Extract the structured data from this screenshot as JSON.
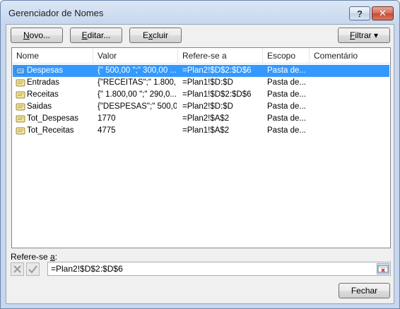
{
  "window": {
    "title": "Gerenciador de Nomes",
    "help_label": "?",
    "close_label": "✕"
  },
  "toolbar": {
    "new_label_u": "N",
    "new_label_rest": "ovo...",
    "edit_label_u": "E",
    "edit_label_rest": "ditar...",
    "delete_label_u": "x",
    "delete_label_pre": "E",
    "delete_label_rest": "cluir",
    "filter_label_u": "F",
    "filter_label_rest": "iltrar ▾"
  },
  "columns": [
    "Nome",
    "Valor",
    "Refere-se a",
    "Escopo",
    "Comentário"
  ],
  "rows": [
    {
      "name": "Despesas",
      "value": "{\" 500,00 \";\" 300,00 ...",
      "refers": "=Plan2!$D$2:$D$6",
      "scope": "Pasta de...",
      "comment": "",
      "selected": true
    },
    {
      "name": "Entradas",
      "value": "{\"RECEITAS\";\" 1.800,...",
      "refers": "=Plan1!$D:$D",
      "scope": "Pasta de...",
      "comment": "",
      "selected": false
    },
    {
      "name": "Receitas",
      "value": "{\" 1.800,00 \";\" 290,0...",
      "refers": "=Plan1!$D$2:$D$6",
      "scope": "Pasta de...",
      "comment": "",
      "selected": false
    },
    {
      "name": "Saidas",
      "value": "{\"DESPESAS\";\" 500,0...",
      "refers": "=Plan2!$D:$D",
      "scope": "Pasta de...",
      "comment": "",
      "selected": false
    },
    {
      "name": "Tot_Despesas",
      "value": "1770",
      "refers": "=Plan2!$A$2",
      "scope": "Pasta de...",
      "comment": "",
      "selected": false
    },
    {
      "name": "Tot_Receitas",
      "value": "4775",
      "refers": "=Plan1!$A$2",
      "scope": "Pasta de...",
      "comment": "",
      "selected": false
    }
  ],
  "refers_to": {
    "label_pre": "Refere-se ",
    "label_u": "a",
    "label_post": ":",
    "value": "=Plan2!$D$2:$D$6"
  },
  "footer": {
    "close_label": "Fechar"
  },
  "colors": {
    "selection": "#3399ff"
  }
}
